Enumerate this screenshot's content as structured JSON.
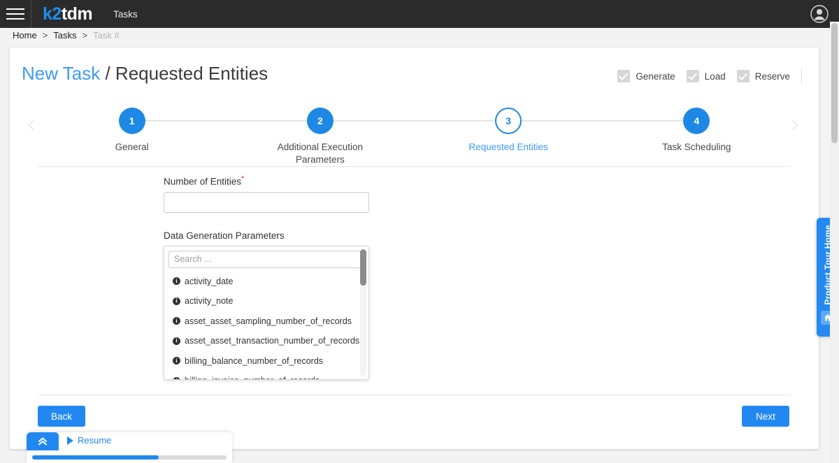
{
  "topbar": {
    "menu_icon": "hamburger-icon",
    "logo_primary": "k2",
    "logo_secondary": "tdm",
    "section": "Tasks",
    "avatar_icon": "user-avatar-icon"
  },
  "breadcrumb": {
    "items": [
      "Home",
      "Tasks",
      "Task #"
    ],
    "separator": ">"
  },
  "header": {
    "title_accent": "New Task",
    "title_rest": "/ Requested Entities"
  },
  "mode_flags": [
    {
      "label": "Generate",
      "checked": true,
      "enabled": false
    },
    {
      "label": "Load",
      "checked": true,
      "enabled": false
    },
    {
      "label": "Reserve",
      "checked": true,
      "enabled": false
    }
  ],
  "stepper": {
    "prev_icon": "chevron-left-icon",
    "next_icon": "chevron-right-icon",
    "steps": [
      {
        "number": "1",
        "label": "General",
        "state": "complete"
      },
      {
        "number": "2",
        "label": "Additional Execution Parameters",
        "state": "complete"
      },
      {
        "number": "3",
        "label": "Requested Entities",
        "state": "active"
      },
      {
        "number": "4",
        "label": "Task Scheduling",
        "state": "complete"
      }
    ]
  },
  "form": {
    "entities": {
      "label": "Number of Entities",
      "required_marker": "*",
      "value": "",
      "placeholder": ""
    },
    "parameters": {
      "label": "Data Generation Parameters",
      "search_placeholder": "Search ...",
      "search_value": "",
      "item_icon": "info-icon",
      "items": [
        "activity_date",
        "activity_note",
        "asset_asset_sampling_number_of_records",
        "asset_asset_transaction_number_of_records",
        "billing_balance_number_of_records",
        "billing_invoice_number_of_records"
      ]
    }
  },
  "footer": {
    "back_label": "Back",
    "next_label": "Next"
  },
  "product_tour": {
    "label": "Product Tour Home",
    "home_icon": "home-icon"
  },
  "resume_widget": {
    "collapse_icon": "chevron-double-up-icon",
    "play_icon": "play-icon",
    "label": "Resume",
    "progress_percent": 65
  },
  "colors": {
    "accent": "#2188f2",
    "topbar": "#2b2b2b",
    "step_active": "#1e88e5",
    "required": "#e03b3b"
  }
}
